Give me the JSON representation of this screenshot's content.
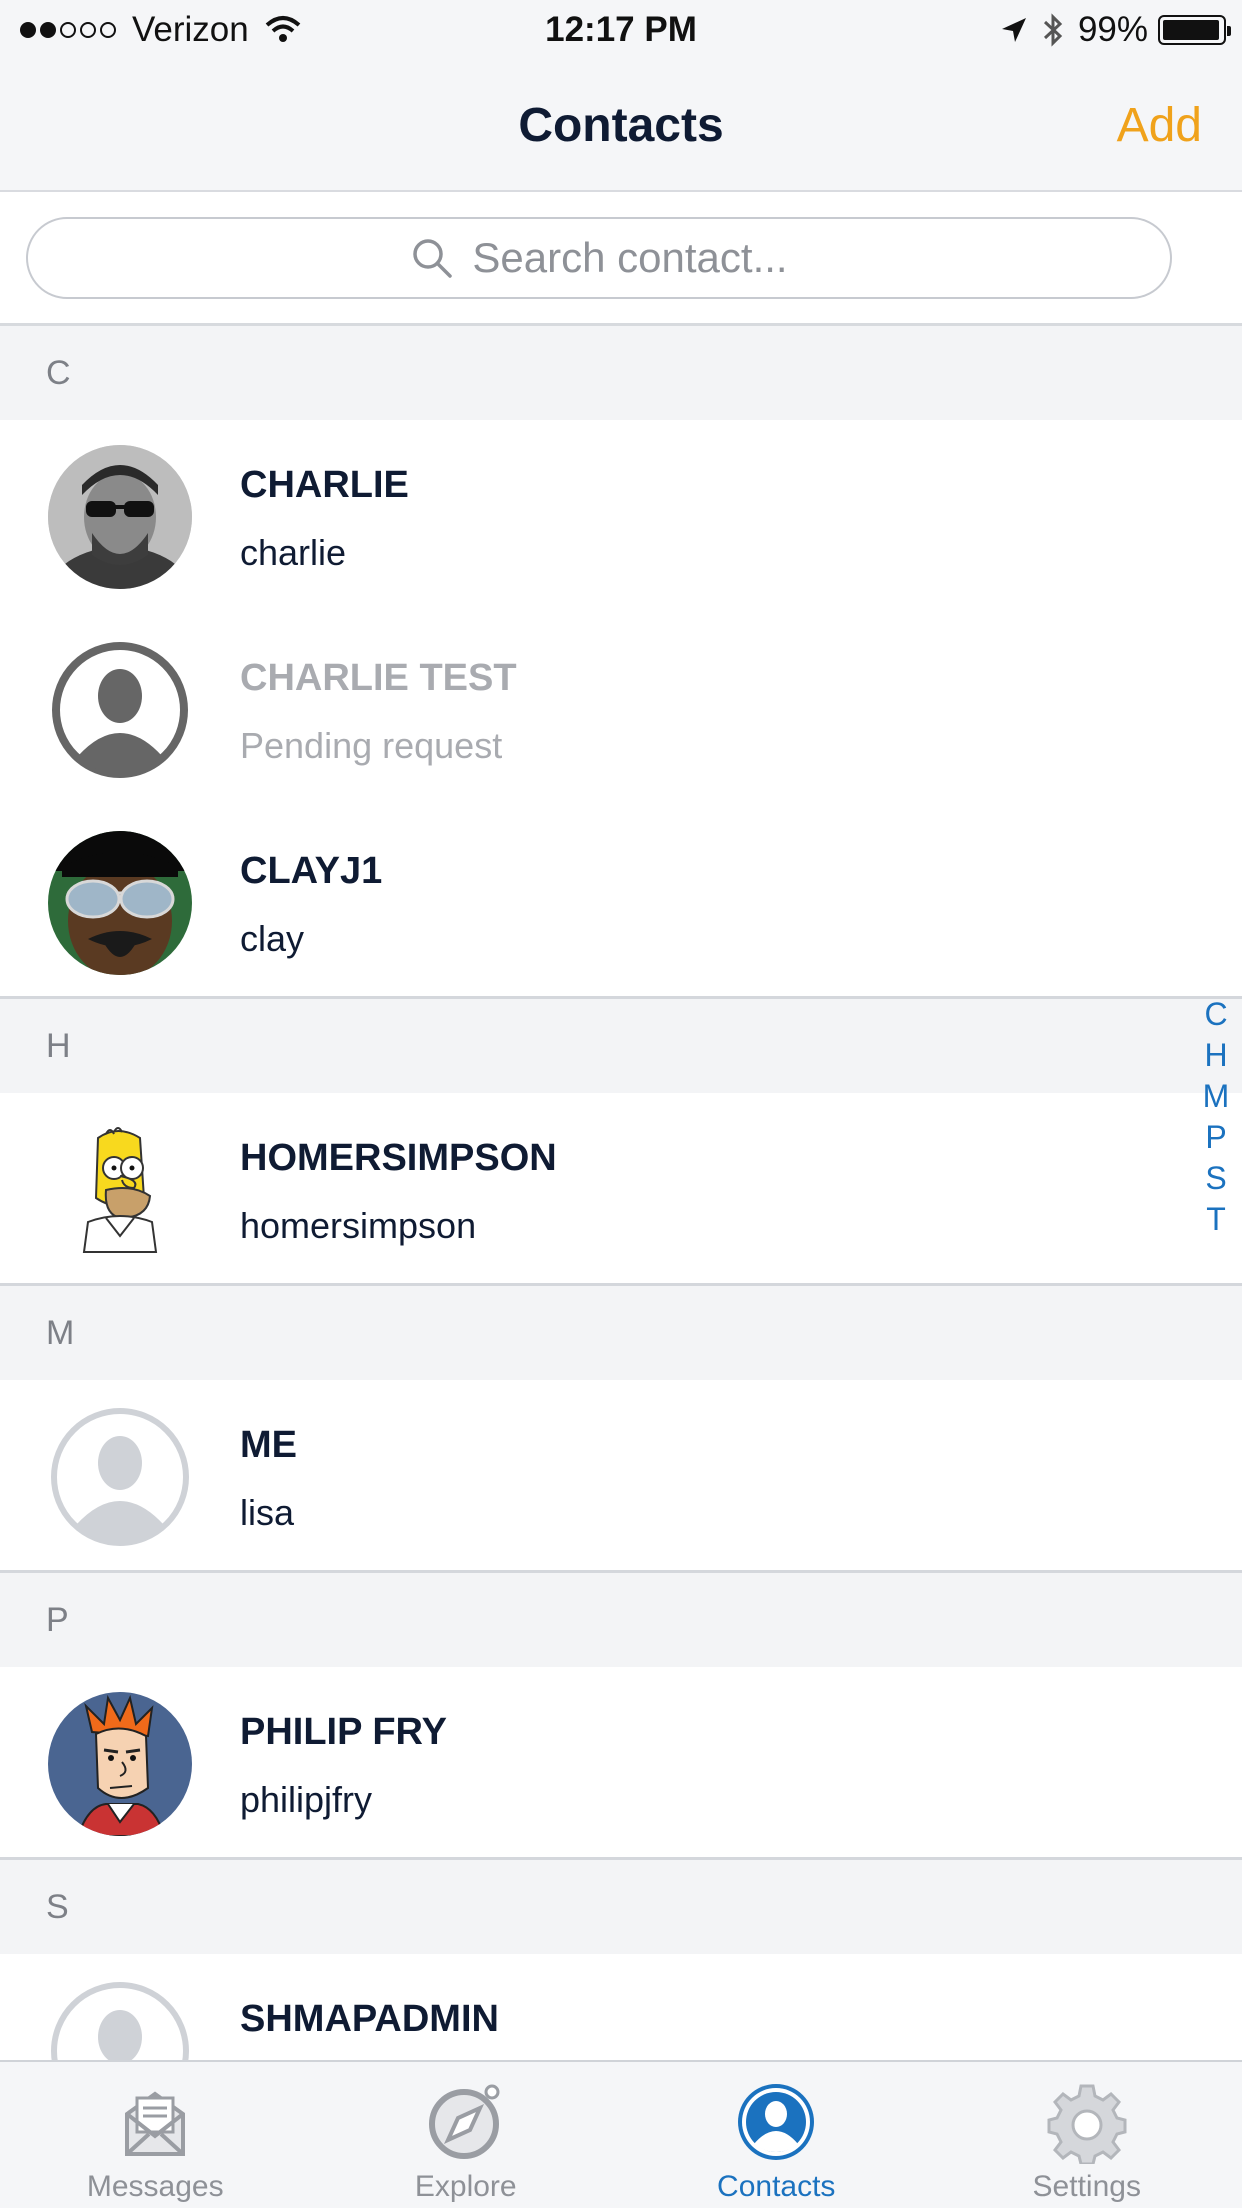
{
  "status_bar": {
    "carrier": "Verizon",
    "time": "12:17 PM",
    "battery": "99%",
    "signal_icon": "signal-dots-icon",
    "wifi_icon": "wifi-icon",
    "location_icon": "location-arrow-icon",
    "bluetooth_icon": "bluetooth-icon"
  },
  "nav": {
    "title": "Contacts",
    "add_label": "Add"
  },
  "search": {
    "placeholder": "Search contact..."
  },
  "sections": [
    {
      "letter": "C",
      "contacts": [
        {
          "name": "CHARLIE",
          "subtitle": "charlie",
          "avatar": "photo-man-sunglasses",
          "pending": false
        },
        {
          "name": "CHARLIE TEST",
          "subtitle": "Pending request",
          "avatar": "default-dark",
          "pending": true
        },
        {
          "name": "CLAYJ1",
          "subtitle": "clay",
          "avatar": "photo-aviator-sunglasses",
          "pending": false
        }
      ]
    },
    {
      "letter": "H",
      "contacts": [
        {
          "name": "HOMERSIMPSON",
          "subtitle": "homersimpson",
          "avatar": "homer-simpson",
          "pending": false
        }
      ]
    },
    {
      "letter": "M",
      "contacts": [
        {
          "name": "ME",
          "subtitle": "lisa",
          "avatar": "default-light",
          "pending": false
        }
      ]
    },
    {
      "letter": "P",
      "contacts": [
        {
          "name": "PHILIP FRY",
          "subtitle": "philipjfry",
          "avatar": "philip-fry",
          "pending": false
        }
      ]
    },
    {
      "letter": "S",
      "contacts": [
        {
          "name": "SHMAPADMIN",
          "subtitle": "",
          "avatar": "default-light",
          "pending": false
        }
      ]
    }
  ],
  "index_letters": [
    "C",
    "H",
    "M",
    "P",
    "S",
    "T"
  ],
  "tabs": [
    {
      "label": "Messages",
      "icon": "envelope-icon",
      "active": false
    },
    {
      "label": "Explore",
      "icon": "compass-icon",
      "active": false
    },
    {
      "label": "Contacts",
      "icon": "person-icon",
      "active": true
    },
    {
      "label": "Settings",
      "icon": "gear-icon",
      "active": false
    }
  ],
  "colors": {
    "accent": "#f0a21b",
    "active_blue": "#1b72bf",
    "text_dark": "#0f1b33",
    "pending_gray": "#a9abb0"
  }
}
